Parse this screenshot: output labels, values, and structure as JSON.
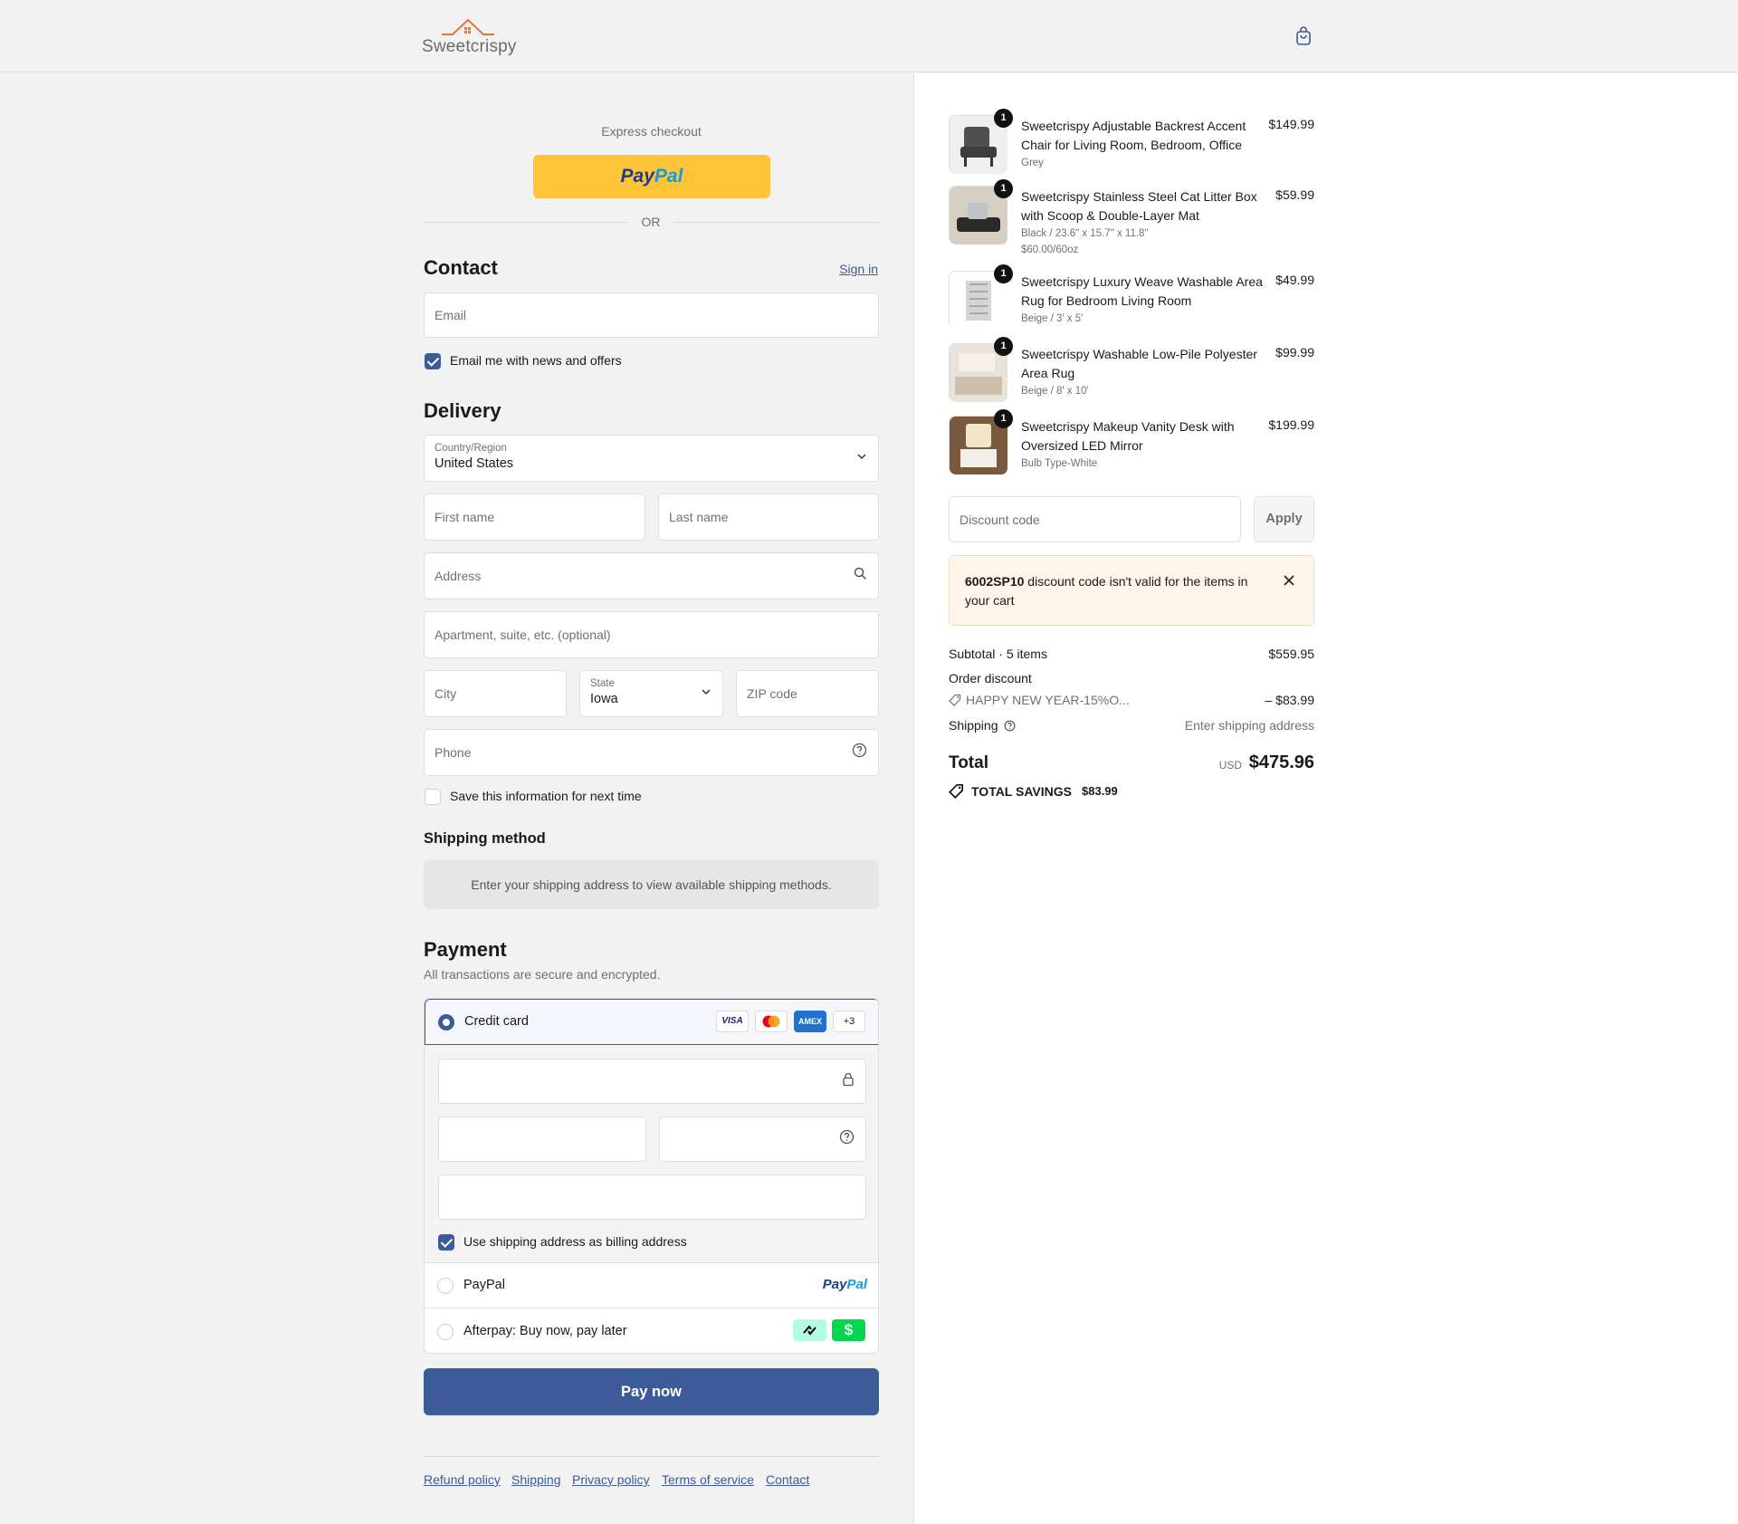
{
  "brand": {
    "name": "Sweetcrispy",
    "accent": "#e8743b"
  },
  "express": {
    "label": "Express checkout",
    "paypal_a": "Pay",
    "paypal_b": "Pal",
    "or": "OR"
  },
  "contact": {
    "title": "Contact",
    "sign_in": "Sign in",
    "email_placeholder": "Email",
    "newsletter_label": "Email me with news and offers"
  },
  "delivery": {
    "title": "Delivery",
    "country_label": "Country/Region",
    "country_value": "United States",
    "first_name": "First name",
    "last_name": "Last name",
    "address": "Address",
    "apartment": "Apartment, suite, etc. (optional)",
    "city": "City",
    "state_label": "State",
    "state_value": "Iowa",
    "zip": "ZIP code",
    "phone": "Phone",
    "save_label": "Save this information for next time"
  },
  "shipping_method": {
    "title": "Shipping method",
    "message": "Enter your shipping address to view available shipping methods."
  },
  "payment": {
    "title": "Payment",
    "subtitle": "All transactions are secure and encrypted.",
    "credit_card": "Credit card",
    "cards": [
      "VISA",
      "",
      "AMEX",
      "+3"
    ],
    "billing_label": "Use shipping address as billing address",
    "paypal": "PayPal",
    "afterpay": "Afterpay: Buy now, pay later",
    "afterpay_icon": "afterpay-icon",
    "cashapp_icon": "cash-app-icon",
    "pay_now": "Pay now"
  },
  "footer": {
    "links": [
      "Refund policy",
      "Shipping",
      "Privacy policy",
      "Terms of service",
      "Contact"
    ]
  },
  "cart": {
    "items": [
      {
        "qty": "1",
        "name": "Sweetcrispy Adjustable Backrest Accent Chair for Living Room, Bedroom, Office",
        "variant": "Grey",
        "unit": "",
        "price": "$149.99"
      },
      {
        "qty": "1",
        "name": "Sweetcrispy Stainless Steel Cat Litter Box with Scoop & Double-Layer Mat",
        "variant": "Black / 23.6\" x 15.7\" x 11.8\"",
        "unit": "$60.00/60oz",
        "price": "$59.99"
      },
      {
        "qty": "1",
        "name": "Sweetcrispy Luxury Weave Washable Area Rug for Bedroom Living Room",
        "variant": "Beige / 3' x 5'",
        "unit": "",
        "price": "$49.99"
      },
      {
        "qty": "1",
        "name": "Sweetcrispy Washable Low-Pile Polyester Area Rug",
        "variant": "Beige / 8' x 10'",
        "unit": "",
        "price": "$99.99"
      },
      {
        "qty": "1",
        "name": "Sweetcrispy Makeup Vanity Desk with Oversized LED Mirror",
        "variant": "Bulb Type-White",
        "unit": "",
        "price": "$199.99"
      }
    ],
    "discount_placeholder": "Discount code",
    "apply": "Apply",
    "alert_code": "6002SP10",
    "alert_text": " discount code isn't valid for the items in your cart",
    "subtotal_label": "Subtotal · 5 items",
    "subtotal": "$559.95",
    "order_discount": "Order discount",
    "discount_name": "HAPPY NEW YEAR-15%O...",
    "discount_value": "– $83.99",
    "shipping_label": "Shipping",
    "shipping_value": "Enter shipping address",
    "total_label": "Total",
    "currency": "USD",
    "total": "$475.96",
    "savings_label": "TOTAL SAVINGS",
    "savings": "$83.99"
  }
}
